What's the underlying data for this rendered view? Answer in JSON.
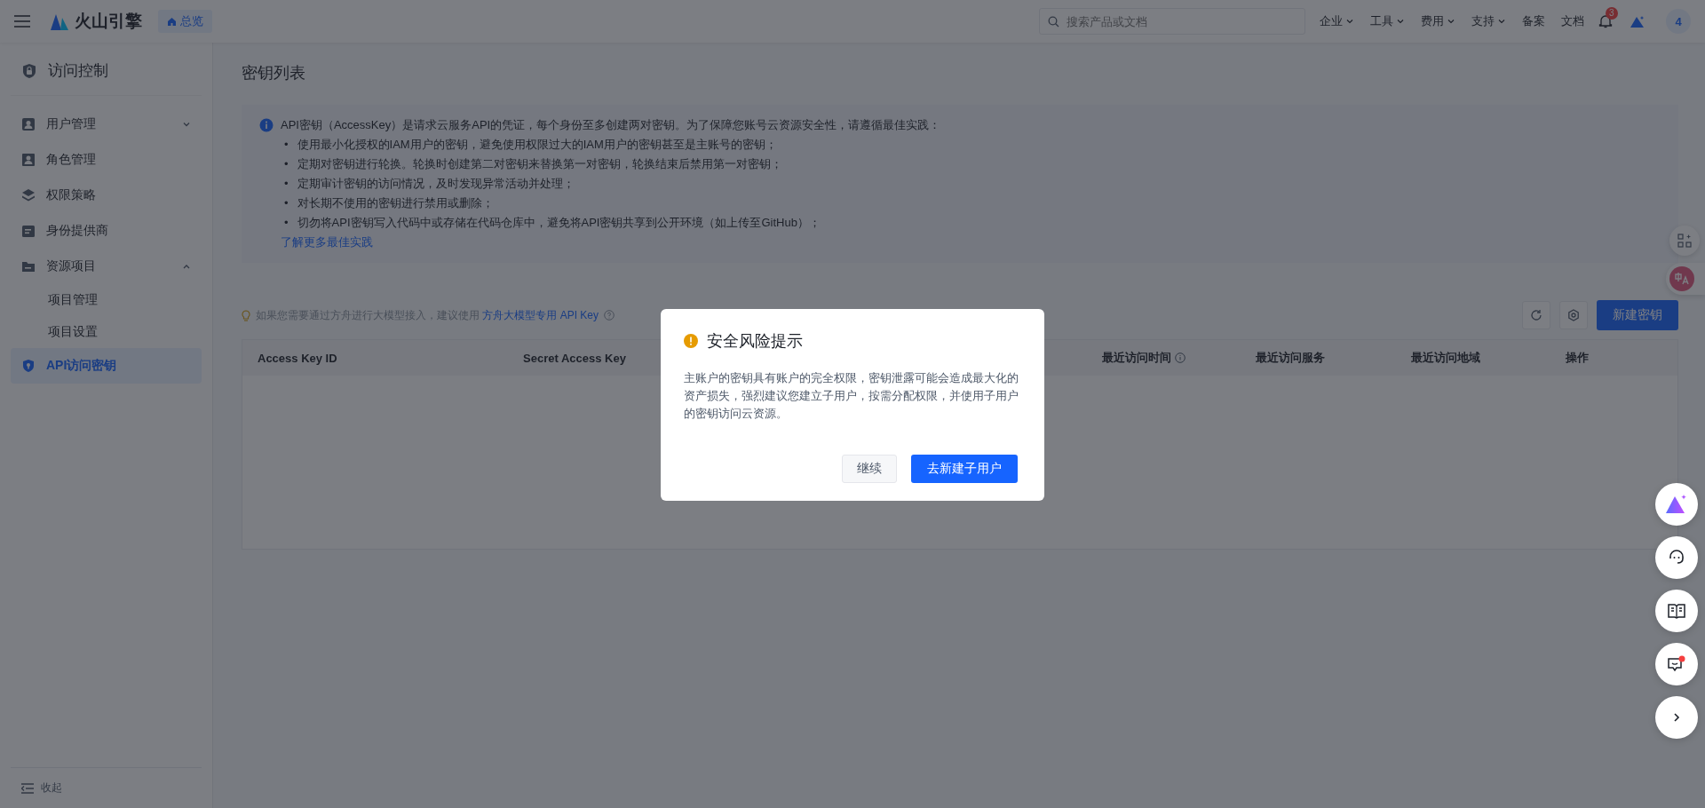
{
  "topbar": {
    "brand": "火山引擎",
    "home": "总览",
    "search": {
      "placeholder": "搜索产品或文档"
    },
    "menus": [
      {
        "label": "企业",
        "dropdown": true
      },
      {
        "label": "工具",
        "dropdown": true
      },
      {
        "label": "费用",
        "dropdown": true
      },
      {
        "label": "支持",
        "dropdown": true
      },
      {
        "label": "备案",
        "dropdown": false
      },
      {
        "label": "文档",
        "dropdown": false
      }
    ],
    "notifications": "3",
    "avatar": "4"
  },
  "sidebar": {
    "title": "访问控制",
    "items": [
      {
        "label": "用户管理",
        "selected": false,
        "expanded": false
      },
      {
        "label": "角色管理",
        "selected": false
      },
      {
        "label": "权限策略",
        "selected": false
      },
      {
        "label": "身份提供商",
        "selected": false
      },
      {
        "label": "资源项目",
        "selected": false,
        "expanded": true,
        "children": [
          {
            "label": "项目管理",
            "selected": false
          },
          {
            "label": "项目设置",
            "selected": false
          }
        ]
      },
      {
        "label": "API访问密钥",
        "selected": true
      }
    ],
    "collapse": "收起"
  },
  "page_title": "密钥列表",
  "info": {
    "intro": "API密钥（AccessKey）是请求云服务API的凭证，每个身份至多创建两对密钥。为了保障您账号云资源安全性，请遵循最佳实践：",
    "bullets": [
      {
        "mark": "•",
        "text": "使用最小化授权的IAM用户的密钥，避免使用权限过大的IAM用户的密钥甚至是主账号的密钥；"
      },
      {
        "mark": "•",
        "text": "定期对密钥进行轮换。轮换时创建第二对密钥来替换第一对密钥，轮换结束后禁用第一对密钥；"
      },
      {
        "mark": "•",
        "text": "定期审计密钥的访问情况，及时发现异常活动并处理；"
      },
      {
        "mark": "•",
        "text": "对长期不使用的密钥进行禁用或删除；"
      },
      {
        "mark": "•",
        "text": "切勿将API密钥写入代码中或存储在代码仓库中，避免将API密钥共享到公开环境（如上传至GitHub）；"
      }
    ],
    "link": "了解更多最佳实践"
  },
  "hint": {
    "text": "如果您需要通过方舟进行大模型接入，建议使用 ",
    "link": "方舟大模型专用 API Key"
  },
  "create_button": "新建密钥",
  "table": {
    "columns": [
      {
        "label": "Access Key ID",
        "info": false
      },
      {
        "label": "Secret Access Key",
        "info": false
      },
      {
        "label": "最近访问时间",
        "info": true
      },
      {
        "label": "最近访问服务",
        "info": false
      },
      {
        "label": "最近访问地域",
        "info": false
      },
      {
        "label": "操作",
        "info": false
      }
    ]
  },
  "dialog": {
    "title": "安全风险提示",
    "message": "主账户的密钥具有账户的完全权限，密钥泄露可能会造成最大化的资产损失，强烈建议您建立子用户，按需分配权限，并使用子用户的密钥访问云资源。",
    "buttons": [
      {
        "label": "继续",
        "kind": "secondary"
      },
      {
        "label": "去新建子用户",
        "kind": "primary"
      }
    ]
  }
}
